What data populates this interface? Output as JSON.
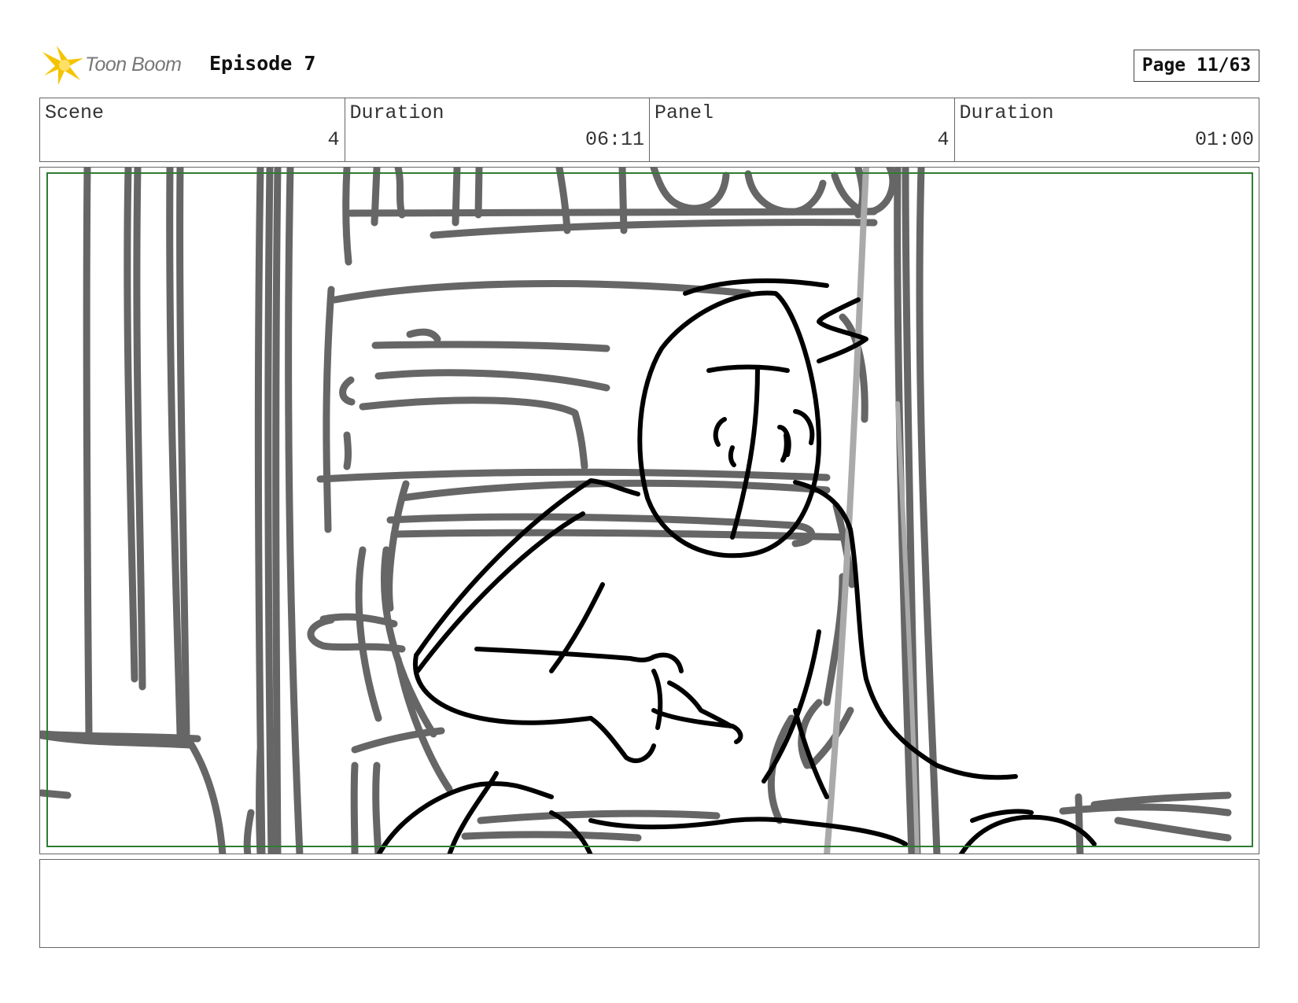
{
  "header": {
    "logo_text": "Toon Boom",
    "episode": "Episode 7",
    "page": "Page 11/63"
  },
  "info": [
    {
      "label": "Scene",
      "value": "4"
    },
    {
      "label": "Duration",
      "value": "06:11"
    },
    {
      "label": "Panel",
      "value": "4"
    },
    {
      "label": "Duration",
      "value": "01:00"
    }
  ],
  "panel": {
    "safe_frame_color": "#2e7d32",
    "background_stroke_color": "#666666",
    "character_stroke_color": "#000000"
  },
  "notes": {
    "text": ""
  }
}
